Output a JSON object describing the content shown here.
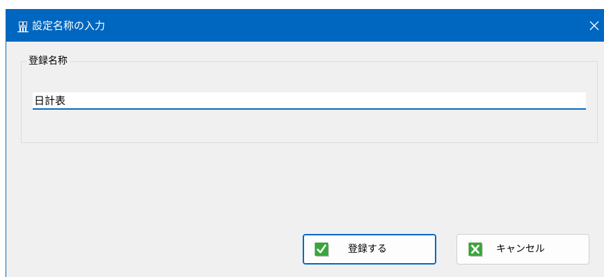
{
  "dialog": {
    "title": "設定名称の入力",
    "group_label": "登録名称",
    "name_value": "日計表",
    "buttons": {
      "register_label": "登録する",
      "cancel_label": "キャンセル"
    }
  },
  "icons": {
    "app": "app-icon",
    "close": "close-icon",
    "register": "green-check-icon",
    "cancel": "green-x-icon"
  },
  "colors": {
    "titlebar": "#0067c0",
    "accent": "#0067c0",
    "dialog_bg": "#f0f0f0",
    "icon_green": "#3aa73a"
  }
}
